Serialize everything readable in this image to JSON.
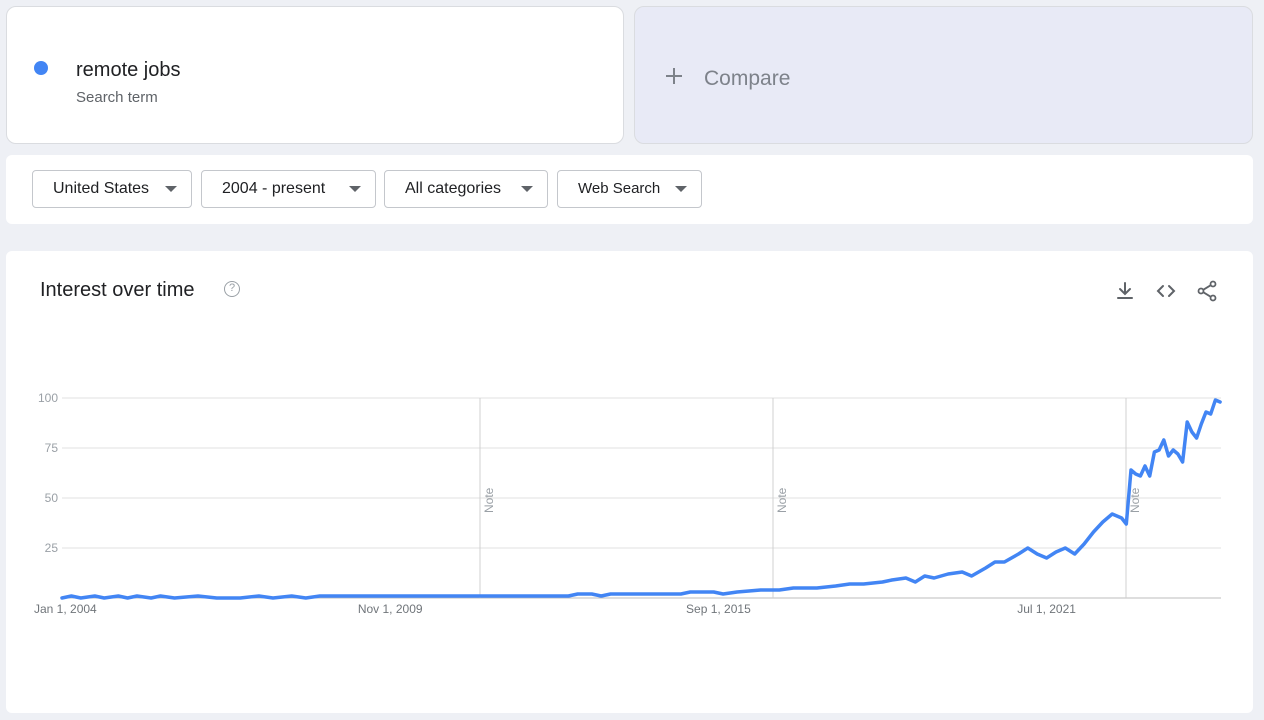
{
  "search_term": {
    "name": "remote jobs",
    "subtitle": "Search term",
    "color": "#4285f4"
  },
  "compare": {
    "icon": "plus-icon",
    "label": "Compare"
  },
  "filters": {
    "region": "United States",
    "time_range": "2004 - present",
    "category": "All categories",
    "property": "Web Search"
  },
  "chart_panel": {
    "title": "Interest over time",
    "icons": [
      "help-icon",
      "download-icon",
      "embed-icon",
      "share-icon"
    ]
  },
  "chart_data": {
    "type": "line",
    "title": "Interest over time",
    "xlabel": "",
    "ylabel": "",
    "x_range": [
      "2004-01-01",
      "2023-11-01"
    ],
    "ylim": [
      0,
      100
    ],
    "y_ticks": [
      100,
      75,
      50,
      25
    ],
    "x_tick_labels": [
      "Jan 1, 2004",
      "Nov 1, 2009",
      "Sep 1, 2015",
      "Jul 1, 2021"
    ],
    "grid": true,
    "notes": [
      {
        "date": "2011-01-01",
        "label": "Note"
      },
      {
        "date": "2016-01-01",
        "label": "Note"
      },
      {
        "date": "2022-01-01",
        "label": "Note"
      }
    ],
    "series": [
      {
        "name": "remote jobs",
        "color": "#4285f4",
        "points": [
          [
            "2004-01",
            0
          ],
          [
            "2004-03",
            1
          ],
          [
            "2004-05",
            0
          ],
          [
            "2004-08",
            1
          ],
          [
            "2004-10",
            0
          ],
          [
            "2005-01",
            1
          ],
          [
            "2005-03",
            0
          ],
          [
            "2005-05",
            1
          ],
          [
            "2005-08",
            0
          ],
          [
            "2005-10",
            1
          ],
          [
            "2006-01",
            0
          ],
          [
            "2006-06",
            1
          ],
          [
            "2006-10",
            0
          ],
          [
            "2007-03",
            0
          ],
          [
            "2007-07",
            1
          ],
          [
            "2007-10",
            0
          ],
          [
            "2008-02",
            1
          ],
          [
            "2008-05",
            0
          ],
          [
            "2008-08",
            1
          ],
          [
            "2008-11",
            1
          ],
          [
            "2009-06",
            1
          ],
          [
            "2010-06",
            1
          ],
          [
            "2011-06",
            1
          ],
          [
            "2012-06",
            1
          ],
          [
            "2013-01",
            1
          ],
          [
            "2013-03",
            2
          ],
          [
            "2013-06",
            2
          ],
          [
            "2013-08",
            1
          ],
          [
            "2013-10",
            2
          ],
          [
            "2014-06",
            2
          ],
          [
            "2015-01",
            2
          ],
          [
            "2015-03",
            3
          ],
          [
            "2015-08",
            3
          ],
          [
            "2015-10",
            2
          ],
          [
            "2016-01",
            3
          ],
          [
            "2016-06",
            4
          ],
          [
            "2016-10",
            4
          ],
          [
            "2017-01",
            5
          ],
          [
            "2017-06",
            5
          ],
          [
            "2017-10",
            6
          ],
          [
            "2018-01",
            7
          ],
          [
            "2018-04",
            7
          ],
          [
            "2018-08",
            8
          ],
          [
            "2018-10",
            9
          ],
          [
            "2019-01",
            10
          ],
          [
            "2019-03",
            8
          ],
          [
            "2019-05",
            11
          ],
          [
            "2019-07",
            10
          ],
          [
            "2019-10",
            12
          ],
          [
            "2020-01",
            13
          ],
          [
            "2020-03",
            11
          ],
          [
            "2020-06",
            15
          ],
          [
            "2020-08",
            18
          ],
          [
            "2020-10",
            18
          ],
          [
            "2021-01",
            22
          ],
          [
            "2021-03",
            25
          ],
          [
            "2021-05",
            22
          ],
          [
            "2021-07",
            20
          ],
          [
            "2021-09",
            23
          ],
          [
            "2021-11",
            25
          ],
          [
            "2022-01",
            22
          ],
          [
            "2022-03",
            27
          ],
          [
            "2022-05",
            33
          ],
          [
            "2022-07",
            38
          ],
          [
            "2022-09",
            42
          ],
          [
            "2022-11",
            40
          ],
          [
            "2022-12",
            37
          ],
          [
            "2023-01",
            64
          ],
          [
            "2023-02",
            62
          ],
          [
            "2023-03",
            61
          ],
          [
            "2023-04",
            66
          ],
          [
            "2023-05",
            61
          ],
          [
            "2023-06",
            73
          ],
          [
            "2023-07",
            74
          ],
          [
            "2023-08",
            79
          ],
          [
            "2023-09",
            71
          ],
          [
            "2023-10",
            74
          ],
          [
            "2023-11",
            72
          ],
          [
            "2023-12",
            68
          ],
          [
            "2024-01",
            88
          ],
          [
            "2024-02",
            83
          ],
          [
            "2024-03",
            80
          ],
          [
            "2024-04",
            87
          ],
          [
            "2024-05",
            93
          ],
          [
            "2024-06",
            92
          ],
          [
            "2024-07",
            99
          ],
          [
            "2024-08",
            98
          ]
        ]
      }
    ]
  }
}
